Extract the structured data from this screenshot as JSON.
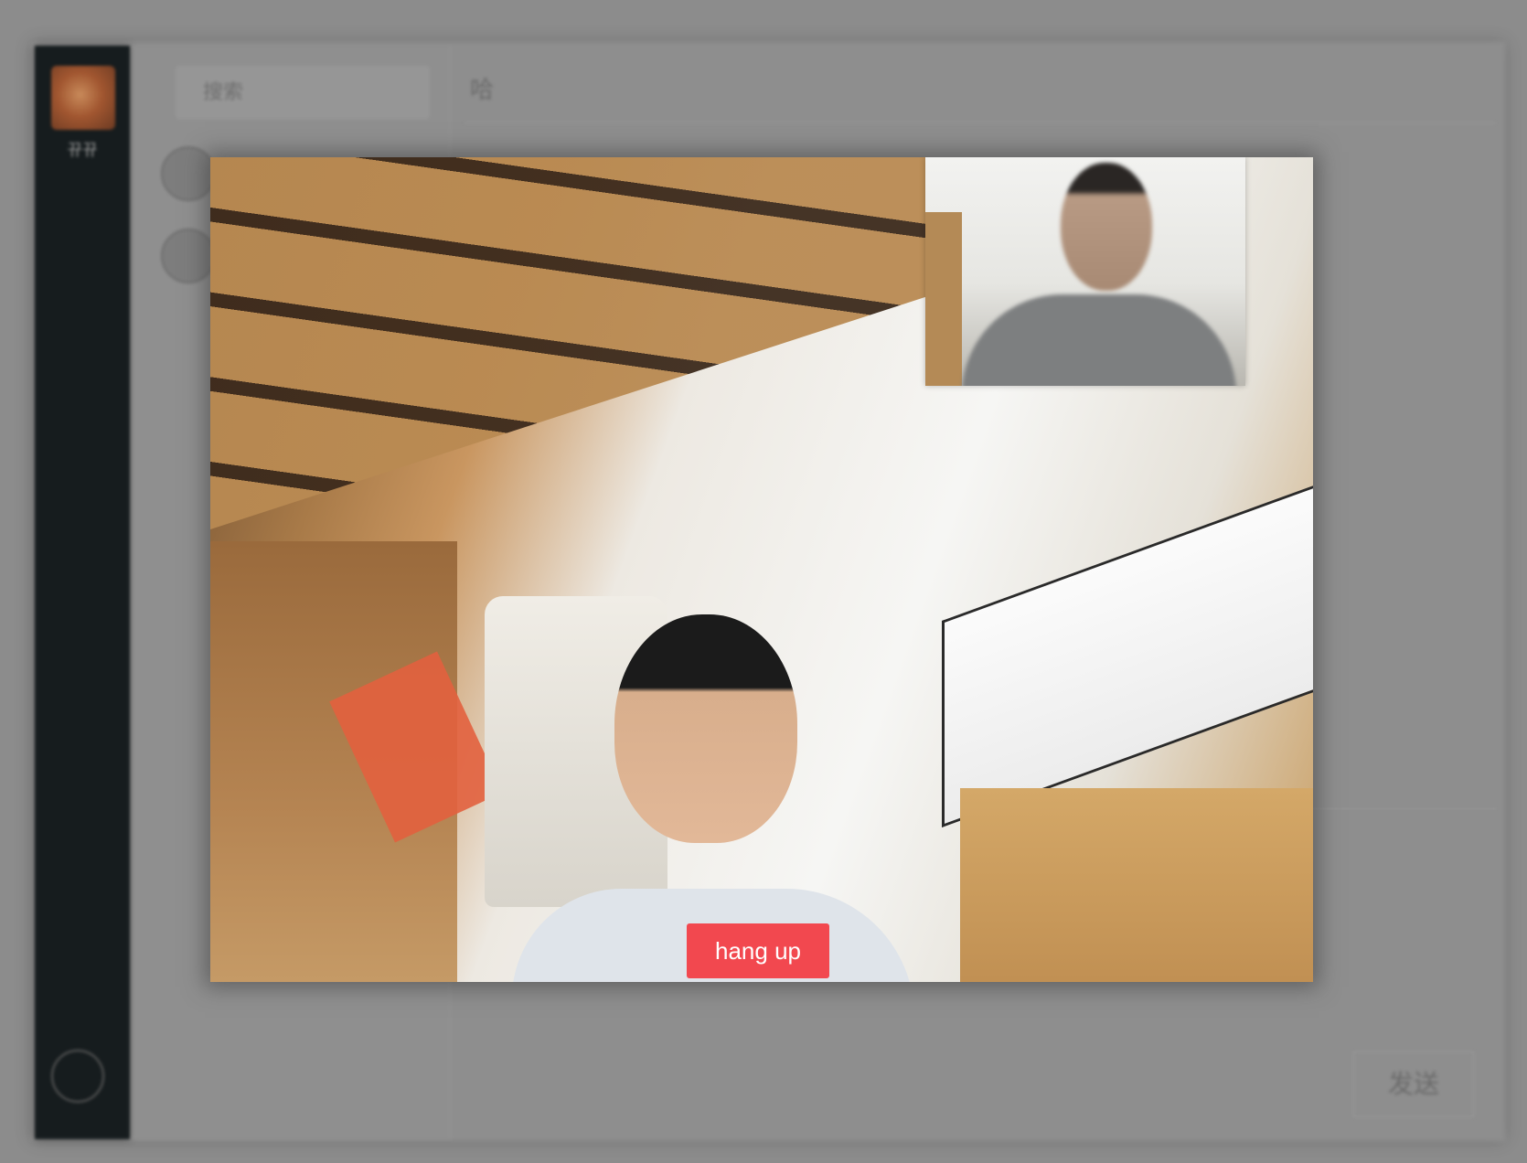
{
  "background_app": {
    "user_name": "뀨뀨",
    "search_placeholder": "搜索",
    "chat_title": "哈",
    "send_label": "发送"
  },
  "call": {
    "hangup_label": "hang up",
    "hangup_color": "#f2484f"
  },
  "icons": {
    "settings": "gear-icon"
  }
}
